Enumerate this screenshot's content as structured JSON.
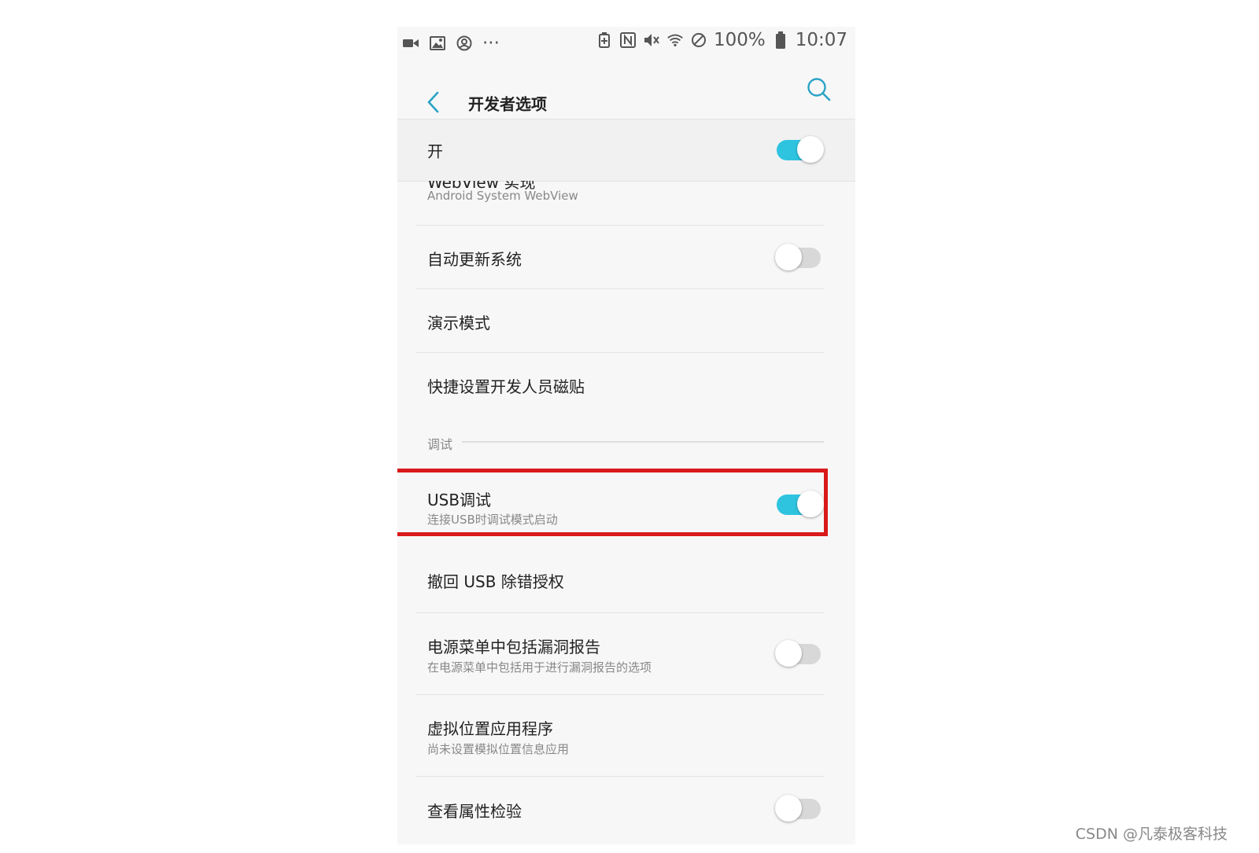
{
  "status_bar": {
    "left_icons": [
      "video-camera-icon",
      "image-icon",
      "account-circle-icon",
      "more-dots-icon"
    ],
    "more_text": "···",
    "right_icons": [
      "battery-saver-icon",
      "nfc-icon",
      "mute-icon",
      "wifi-icon",
      "do-not-disturb-icon"
    ],
    "battery_percent": "100%",
    "time": "10:07"
  },
  "header": {
    "title": "开发者选项"
  },
  "master_switch": {
    "label": "开",
    "state": "on"
  },
  "settings": {
    "webview": {
      "title": "WebView 实现",
      "subtitle": "Android System WebView"
    },
    "auto_update": {
      "title": "自动更新系统",
      "state": "off"
    },
    "demo_mode": {
      "title": "演示模式"
    },
    "quick_tiles": {
      "title": "快捷设置开发人员磁贴"
    },
    "debug_section": "调试",
    "usb_debug": {
      "title": "USB调试",
      "subtitle": "连接USB时调试模式启动",
      "state": "on"
    },
    "revoke_usb": {
      "title": "撤回 USB 除错授权"
    },
    "bug_report": {
      "title": "电源菜单中包括漏洞报告",
      "subtitle": "在电源菜单中包括用于进行漏洞报告的选项",
      "state": "off"
    },
    "mock_location": {
      "title": "虚拟位置应用程序",
      "subtitle": "尚未设置模拟位置信息应用"
    },
    "view_attr": {
      "title": "查看属性检验",
      "state": "off"
    }
  },
  "colors": {
    "accent": "#2ec4e0",
    "highlight_border": "#d91a1a"
  },
  "watermark": "CSDN @凡泰极客科技"
}
